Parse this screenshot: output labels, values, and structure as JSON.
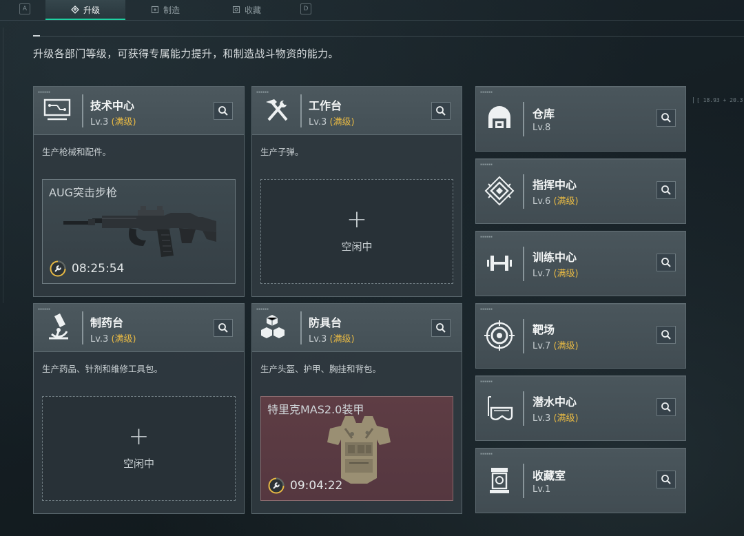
{
  "nav": {
    "key_left": "A",
    "key_right": "D",
    "tabs": [
      {
        "label": "升级",
        "icon": "upgrade-icon",
        "active": true
      },
      {
        "label": "制造",
        "icon": "craft-icon",
        "active": false
      },
      {
        "label": "收藏",
        "icon": "collection-icon",
        "active": false
      }
    ]
  },
  "description": "升级各部门等级，可获得专属能力提升，和制造战斗物资的能力。",
  "coord_readout": "[ 18.93 + 20.3",
  "maxed_label": "(满级)",
  "colors": {
    "accent": "#1fd1a2",
    "maxed": "#e7b944",
    "armor_slot": "#5e3d44"
  },
  "large_cards": [
    {
      "id": "tech",
      "title": "技术中心",
      "level": "Lv.3",
      "maxed": true,
      "icon": "monitor-icon",
      "description": "生产枪械和配件。",
      "slot": {
        "state": "crafting",
        "item_name": "AUG突击步枪",
        "timer": "08:25:54",
        "art": "rifle"
      }
    },
    {
      "id": "workbench",
      "title": "工作台",
      "level": "Lv.3",
      "maxed": true,
      "icon": "hammer-wrench-icon",
      "description": "生产子弹。",
      "slot": {
        "state": "idle",
        "plus": "+",
        "idle_label": "空闲中"
      }
    },
    {
      "id": "pharmacy",
      "title": "制药台",
      "level": "Lv.3",
      "maxed": true,
      "icon": "microscope-icon",
      "description": "生产药品、针剂和维修工具包。",
      "slot": {
        "state": "idle",
        "plus": "+",
        "idle_label": "空闲中"
      }
    },
    {
      "id": "armor",
      "title": "防具台",
      "level": "Lv.3",
      "maxed": true,
      "icon": "cubes-icon",
      "description": "生产头盔、护甲、胸挂和背包。",
      "slot": {
        "state": "crafting",
        "item_name": "特里克MAS2.0装甲",
        "timer": "09:04:22",
        "art": "vest"
      }
    }
  ],
  "small_cards": [
    {
      "id": "warehouse",
      "title": "仓库",
      "level": "Lv.8",
      "maxed": false,
      "icon": "warehouse-icon"
    },
    {
      "id": "command",
      "title": "指挥中心",
      "level": "Lv.6",
      "maxed": true,
      "icon": "command-emblem-icon"
    },
    {
      "id": "training",
      "title": "训练中心",
      "level": "Lv.7",
      "maxed": true,
      "icon": "dumbbell-icon"
    },
    {
      "id": "range",
      "title": "靶场",
      "level": "Lv.7",
      "maxed": true,
      "icon": "target-icon"
    },
    {
      "id": "diving",
      "title": "潜水中心",
      "level": "Lv.3",
      "maxed": true,
      "icon": "diving-mask-icon"
    },
    {
      "id": "collection",
      "title": "收藏室",
      "level": "Lv.1",
      "maxed": false,
      "icon": "display-case-icon"
    }
  ]
}
